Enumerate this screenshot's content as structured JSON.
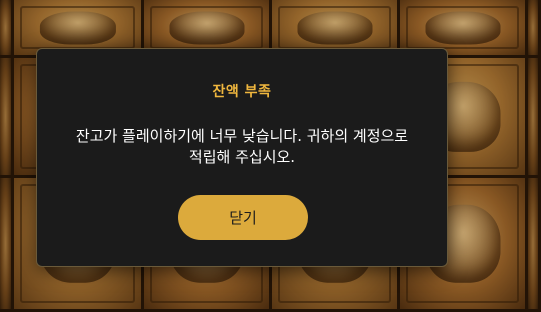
{
  "dialog": {
    "title": "잔액 부족",
    "message": "잔고가 플레이하기에 너무 낮습니다. 귀하의 계정으로 적립해 주십시오.",
    "close_label": "닫기"
  },
  "colors": {
    "title": "#f0b73e",
    "button": "#dcaa3c",
    "modal_bg": "#1b1b1b"
  }
}
